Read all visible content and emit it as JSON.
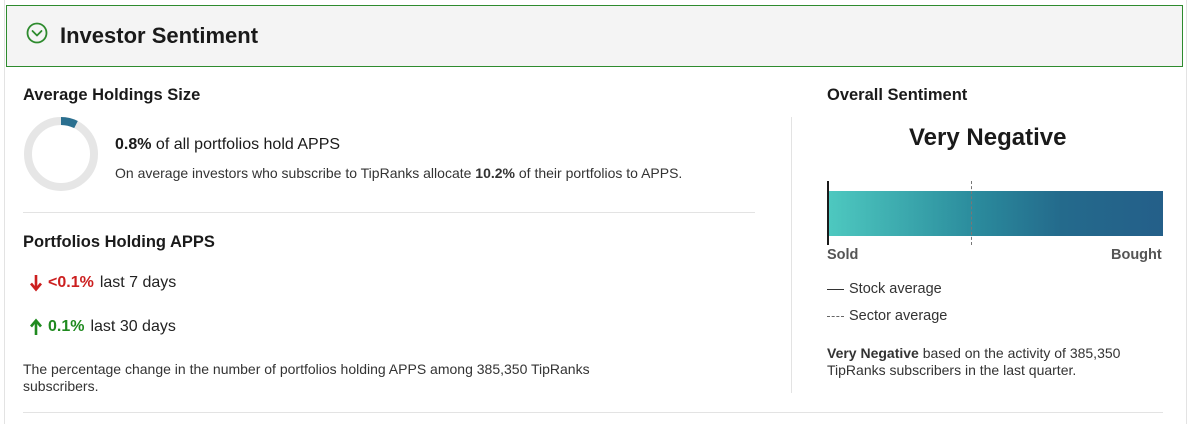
{
  "header": {
    "title": "Investor Sentiment"
  },
  "holdings": {
    "title": "Average Holdings Size",
    "pct": "0.8%",
    "pct_value": 0.8,
    "line_text": "of all portfolios hold APPS",
    "sub_prefix": "On average investors who subscribe to TipRanks allocate",
    "sub_pct": "10.2%",
    "sub_suffix": "of their portfolios to APPS.",
    "colors": {
      "fill": "#2a6f8f",
      "track": "#e6e6e6"
    }
  },
  "portfolios": {
    "title": "Portfolios Holding APPS",
    "changes": [
      {
        "direction": "down",
        "icon": "arrow-down-icon",
        "value": "<0.1%",
        "period": "last 7 days",
        "color": "#cc1f1f"
      },
      {
        "direction": "up",
        "icon": "arrow-up-icon",
        "value": "0.1%",
        "period": "last 30 days",
        "color": "#1f8a1f"
      }
    ],
    "note": "The percentage change in the number of portfolios holding APPS among 385,350 TipRanks subscribers."
  },
  "overall": {
    "title": "Overall Sentiment",
    "label": "Very Negative",
    "scale_min_label": "Sold",
    "scale_max_label": "Bought",
    "stock_average_position": 0.0,
    "sector_average_position": 0.43,
    "legend": {
      "stock": "Stock average",
      "sector": "Sector average"
    },
    "desc_bold": "Very Negative",
    "desc_rest": "based on the activity of 385,350 TipRanks subscribers in the last quarter."
  }
}
